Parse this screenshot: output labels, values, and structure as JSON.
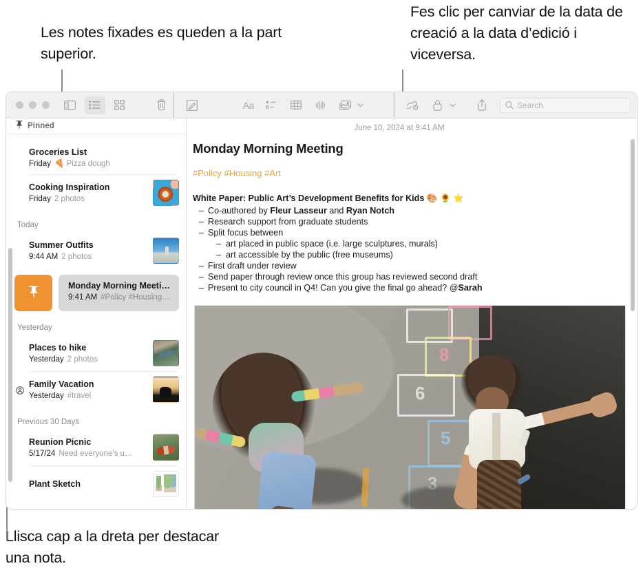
{
  "callouts": {
    "pinned": "Les notes fixades es queden a la part superior.",
    "date": "Fes clic per canviar de la data de creació a la data d’edició i viceversa.",
    "swipe": "Llisca cap a la dreta per destacar una nota."
  },
  "toolbar": {
    "sidebar_toggle": "sidebar-toggle-icon",
    "list_view": "list-view-icon",
    "gallery_view": "gallery-view-icon",
    "delete": "trash-icon",
    "compose": "compose-note-icon",
    "format": "Aa",
    "checklist": "checklist-icon",
    "table": "table-icon",
    "audio": "audio-waveform-icon",
    "media": "media-icon",
    "media_chevron": "chevron-down-icon",
    "collaborate": "collaborate-link-icon",
    "lock": "lock-icon",
    "lock_chevron": "chevron-down-icon",
    "share": "share-icon",
    "search_icon": "search-icon",
    "search_placeholder": "Search",
    "search_value": ""
  },
  "sidebar": {
    "pinned_header": {
      "label": "Pinned",
      "icon": "pin-icon"
    },
    "groups": [
      {
        "label": "",
        "notes": [
          {
            "title": "Groceries List",
            "date": "Friday",
            "snippet": "🍕 Pizza dough",
            "thumb": "",
            "shared": false
          },
          {
            "title": "Cooking Inspiration",
            "date": "Friday",
            "snippet": "2 photos",
            "thumb": "th-pizza",
            "shared": false
          }
        ]
      },
      {
        "label": "Today",
        "notes": [
          {
            "title": "Summer Outfits",
            "date": "9:44 AM",
            "snippet": "2 photos",
            "thumb": "th-beach",
            "shared": false
          }
        ]
      },
      {
        "label": "Yesterday",
        "notes": [
          {
            "title": "Places to hike",
            "date": "Yesterday",
            "snippet": "2 photos",
            "thumb": "th-hike",
            "shared": false
          },
          {
            "title": "Family Vacation",
            "date": "Yesterday",
            "snippet": "#travel",
            "thumb": "th-bike",
            "shared": true
          }
        ]
      },
      {
        "label": "Previous 30 Days",
        "notes": [
          {
            "title": "Reunion Picnic",
            "date": "5/17/24",
            "snippet": "Need everyone's u…",
            "thumb": "th-picnic",
            "shared": false
          },
          {
            "title": "Plant Sketch",
            "date": "",
            "snippet": "",
            "thumb": "th-plant",
            "shared": false
          }
        ]
      }
    ],
    "swipe_row": {
      "pin_action_icon": "pin-icon",
      "pin_action_color": "#ef9233",
      "note": {
        "title": "Monday Morning Meeting",
        "date": "9:41 AM",
        "snippet": "#Policy #Housing…"
      }
    }
  },
  "detail": {
    "date": "June 10, 2024 at 9:41 AM",
    "heading": "Monday Morning Meeting",
    "tags": "#Policy #Housing #Art",
    "tags_color": "#e8a33d",
    "subheading": "White Paper: Public Art’s Development Benefits for Kids 🎨 🌻 ⭐",
    "bullets": [
      {
        "level": 1,
        "pre": "Co-authored by ",
        "bold1": "Fleur Lasseur",
        "mid": " and ",
        "bold2": "Ryan Notch",
        "post": ""
      },
      {
        "level": 1,
        "pre": "Research support from graduate students",
        "bold1": "",
        "mid": "",
        "bold2": "",
        "post": ""
      },
      {
        "level": 1,
        "pre": "Split focus between",
        "bold1": "",
        "mid": "",
        "bold2": "",
        "post": ""
      },
      {
        "level": 2,
        "pre": "art placed in public space (i.e. large sculptures, murals)",
        "bold1": "",
        "mid": "",
        "bold2": "",
        "post": ""
      },
      {
        "level": 2,
        "pre": "art accessible by the public (free museums)",
        "bold1": "",
        "mid": "",
        "bold2": "",
        "post": ""
      },
      {
        "level": 1,
        "pre": "First draft under review",
        "bold1": "",
        "mid": "",
        "bold2": "",
        "post": ""
      },
      {
        "level": 1,
        "pre": "Send paper through review once this group has reviewed second draft",
        "bold1": "",
        "mid": "",
        "bold2": "",
        "post": ""
      },
      {
        "level": 1,
        "pre": "Present to city council in Q4! Can you give the final go ahead? @",
        "bold1": "Sarah",
        "mid": "",
        "bold2": "",
        "post": ""
      }
    ],
    "photo": {
      "alt": "two children playing hopscotch on asphalt seen from above",
      "chalk_numbers": [
        "8",
        "6",
        "5",
        "3"
      ]
    }
  }
}
